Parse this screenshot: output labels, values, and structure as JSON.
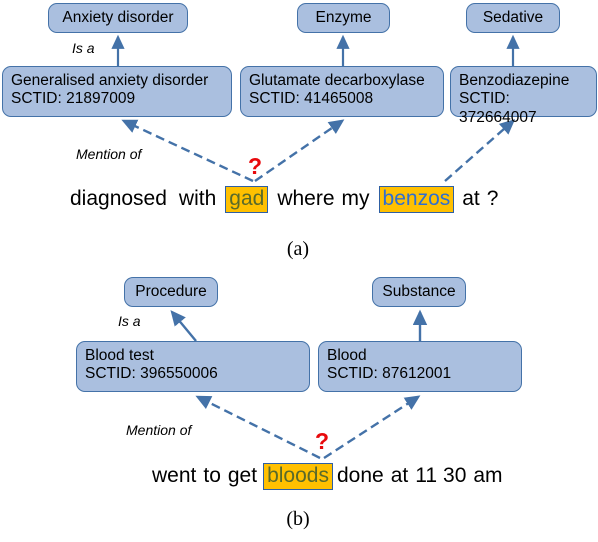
{
  "figure": {
    "panels": [
      {
        "id": "a",
        "caption": "(a)",
        "relations": {
          "is_a": "Is a",
          "mention_of": "Mention of"
        },
        "ambiguity_marker": "?",
        "type_nodes": [
          {
            "label": "Anxiety disorder"
          },
          {
            "label": "Enzyme"
          },
          {
            "label": "Sedative"
          }
        ],
        "concept_nodes": [
          {
            "name": "Generalised anxiety disorder",
            "code": "SCTID: 21897009"
          },
          {
            "name": "Glutamate decarboxylase",
            "code": "SCTID: 41465008"
          },
          {
            "name": "Benzodiazepine",
            "code": "SCTID: 372664007"
          }
        ],
        "sentence": [
          {
            "text": "diagnosed",
            "highlight": false
          },
          {
            "text": "with",
            "highlight": false
          },
          {
            "text": "gad",
            "highlight": true,
            "color": "olive"
          },
          {
            "text": "where",
            "highlight": false
          },
          {
            "text": "my",
            "highlight": false
          },
          {
            "text": "benzos",
            "highlight": true,
            "color": "blue"
          },
          {
            "text": "at",
            "highlight": false
          },
          {
            "text": "?",
            "highlight": false
          }
        ]
      },
      {
        "id": "b",
        "caption": "(b)",
        "relations": {
          "is_a": "Is a",
          "mention_of": "Mention of"
        },
        "ambiguity_marker": "?",
        "type_nodes": [
          {
            "label": "Procedure"
          },
          {
            "label": "Substance"
          }
        ],
        "concept_nodes": [
          {
            "name": "Blood test",
            "code": "SCTID: 396550006"
          },
          {
            "name": "Blood",
            "code": "SCTID: 87612001"
          }
        ],
        "sentence": [
          {
            "text": "went",
            "highlight": false
          },
          {
            "text": "to",
            "highlight": false
          },
          {
            "text": "get",
            "highlight": false
          },
          {
            "text": "bloods",
            "highlight": true,
            "color": "olive"
          },
          {
            "text": "done",
            "highlight": false
          },
          {
            "text": "at",
            "highlight": false
          },
          {
            "text": "11",
            "highlight": false
          },
          {
            "text": "30",
            "highlight": false
          },
          {
            "text": "am",
            "highlight": false
          }
        ]
      }
    ]
  },
  "colors": {
    "node_fill": "#aabfdf",
    "node_border": "#4472a8",
    "edge_blue": "#4472a8",
    "mention_fill": "#ffc000",
    "mention_border": "#2e5fa3",
    "question_red": "#e8090c",
    "mention_text_olive": "#5a6a2a",
    "mention_text_blue": "#2f6ed1"
  }
}
